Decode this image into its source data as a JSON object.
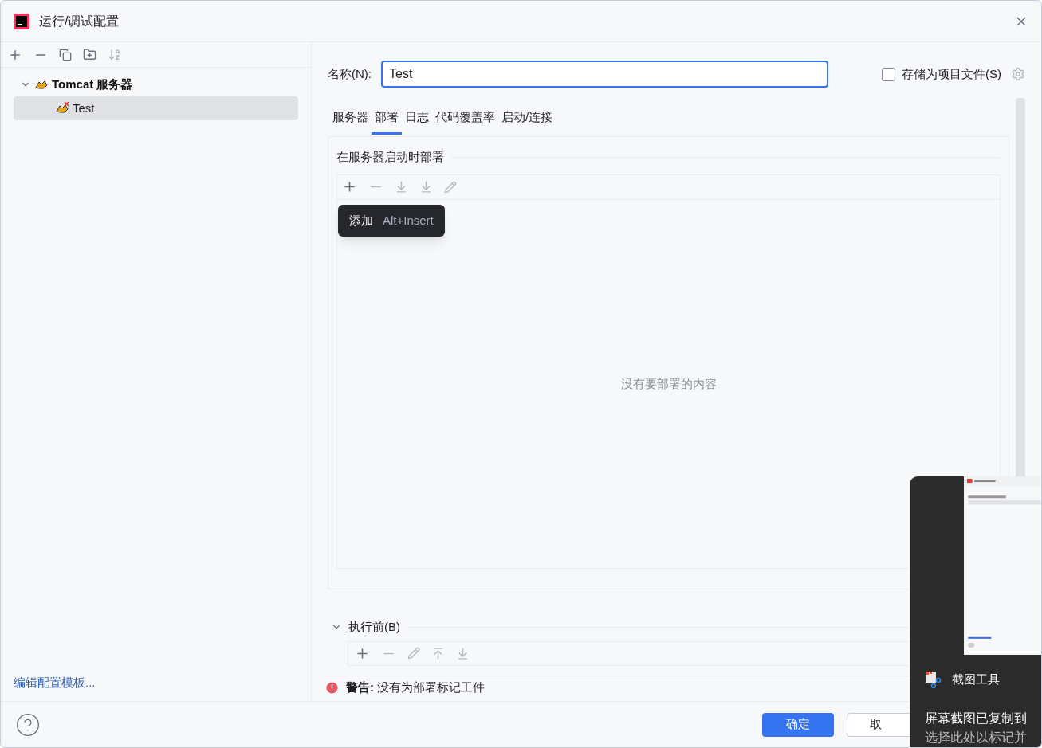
{
  "window": {
    "title": "运行/调试配置"
  },
  "sidebar": {
    "tree": [
      {
        "label": "Tomcat 服务器",
        "expanded": true,
        "selected": false,
        "children": [
          {
            "label": "Test",
            "selected": true,
            "error": true
          }
        ]
      }
    ],
    "footer_link": "编辑配置模板..."
  },
  "form": {
    "name_label": "名称(N):",
    "name_value": "Test",
    "store_checkbox": {
      "label": "存储为项目文件(S)",
      "checked": false
    }
  },
  "tabs": [
    {
      "label": "服务器",
      "selected": false
    },
    {
      "label": "部署",
      "selected": true
    },
    {
      "label": "日志",
      "selected": false
    },
    {
      "label": "代码覆盖率",
      "selected": false
    },
    {
      "label": "启动/连接",
      "selected": false
    }
  ],
  "deploy": {
    "section_title": "在服务器启动时部署",
    "empty_text": "没有要部署的内容",
    "tooltip": {
      "label": "添加",
      "shortcut": "Alt+Insert"
    }
  },
  "before_launch": {
    "title": "执行前(B)",
    "expanded": true
  },
  "warning": {
    "label": "警告:",
    "text": "没有为部署标记工件"
  },
  "buttons": [
    {
      "label": "确定",
      "primary": true
    },
    {
      "label": "取",
      "primary": false
    }
  ],
  "toast": {
    "app": "截图工具",
    "line_1": "屏幕截图已复制到",
    "line_2": "选择此处以标记并"
  }
}
